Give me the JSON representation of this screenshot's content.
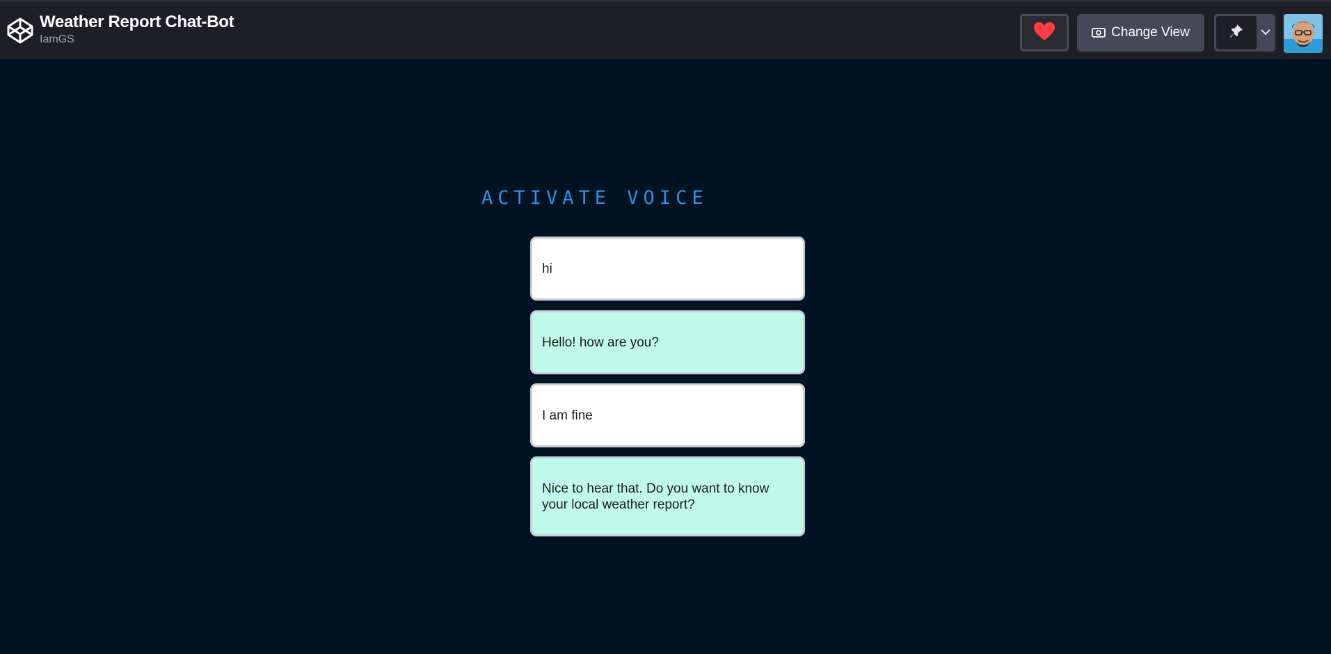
{
  "header": {
    "title": "Weather Report Chat-Bot",
    "author": "IamGS",
    "logo_icon": "codepen-logo-icon",
    "like_icon": "heart-icon",
    "change_view_label": "Change View",
    "change_view_icon": "eye-icon",
    "pin_icon": "pin-icon",
    "menu_icon": "chevron-down-icon",
    "avatar": "user-avatar"
  },
  "app": {
    "voice_label": "ACTIVATE VOICE",
    "messages": [
      {
        "role": "user",
        "text": "hi"
      },
      {
        "role": "bot",
        "text": "Hello! how are you?"
      },
      {
        "role": "user",
        "text": "I am fine"
      },
      {
        "role": "bot",
        "text": "Nice to hear that. Do you want to know your local weather report?"
      }
    ]
  },
  "colors": {
    "background": "#011222",
    "topbar": "#1e1f26",
    "accent_blue": "#2e8fe0",
    "bot_bubble": "#c0fbea",
    "user_bubble": "#ffffff",
    "heart": "#ff3c41"
  }
}
